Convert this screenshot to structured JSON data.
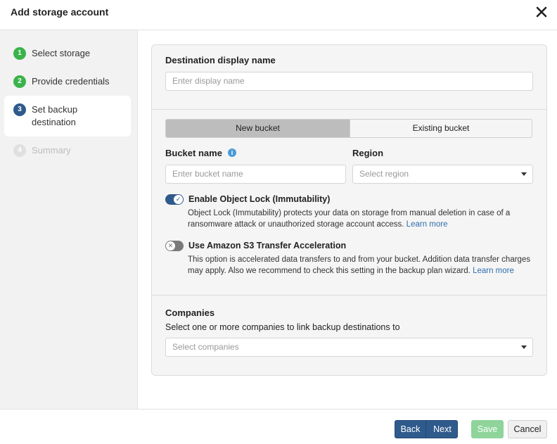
{
  "dialog": {
    "title": "Add storage account",
    "close_icon": "close-icon"
  },
  "steps": [
    {
      "number": "1",
      "label": "Select storage",
      "state": "done"
    },
    {
      "number": "2",
      "label": "Provide credentials",
      "state": "done"
    },
    {
      "number": "3",
      "label_line1": "Set backup",
      "label_line2": "destination",
      "state": "active"
    },
    {
      "number": "4",
      "label": "Summary",
      "state": "disabled"
    }
  ],
  "destination": {
    "label": "Destination display name",
    "placeholder": "Enter display name"
  },
  "bucket_mode": {
    "options": [
      "New bucket",
      "Existing bucket"
    ],
    "selected": "New bucket"
  },
  "bucket_name": {
    "label": "Bucket name",
    "info_icon": "info-icon",
    "placeholder": "Enter bucket name"
  },
  "region": {
    "label": "Region",
    "placeholder": "Select region"
  },
  "object_lock": {
    "enabled": true,
    "title": "Enable Object Lock (Immutability)",
    "desc_line1": "Object Lock (Immutability) protects your data on storage from manual deletion in case of a",
    "desc_line2": "ransomware attack or unauthorized storage account access.",
    "link": "Learn more"
  },
  "transfer_accel": {
    "enabled": false,
    "title": "Use Amazon S3 Transfer Acceleration",
    "desc_line1": "This option is accelerated data transfers to and from your bucket. Addition data transfer charges",
    "desc_line2": "may apply. Also we recommend to check this setting in the backup plan wizard.",
    "link": "Learn more"
  },
  "companies": {
    "label": "Companies",
    "description": "Select one or more companies to link backup destinations to",
    "placeholder": "Select companies"
  },
  "footer": {
    "back_label": "Back",
    "next_label": "Next",
    "save_label": "Save",
    "cancel_label": "Cancel"
  },
  "colors": {
    "primary": "#2f5a8c",
    "success": "#3bb34a",
    "save_disabled": "#8fd49a",
    "link": "#2f6fae"
  }
}
